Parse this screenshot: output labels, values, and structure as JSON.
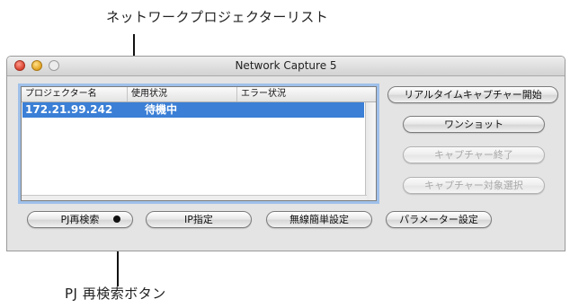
{
  "callouts": {
    "top_label": "ネットワークプロジェクターリスト",
    "bottom_label": "PJ 再検索ボタン"
  },
  "window": {
    "title": "Network Capture 5"
  },
  "projector_list": {
    "columns": [
      "プロジェクター名",
      "使用状況",
      "エラー状況"
    ],
    "rows": [
      {
        "name": "172.21.99.242",
        "usage": "待機中",
        "error": ""
      }
    ]
  },
  "buttons": {
    "realtime_capture_start": "リアルタイムキャプチャー開始",
    "one_shot": "ワンショット",
    "capture_end": "キャプチャー終了",
    "capture_target_select": "キャプチャー対象選択",
    "pj_research": "PJ再検索",
    "ip_specify": "IP指定",
    "wireless_easy_setup": "無線簡単設定",
    "parameter_setup": "パラメーター設定"
  },
  "colors": {
    "selection": "#3b7fd6",
    "focus_ring": "#9fc0ea"
  }
}
